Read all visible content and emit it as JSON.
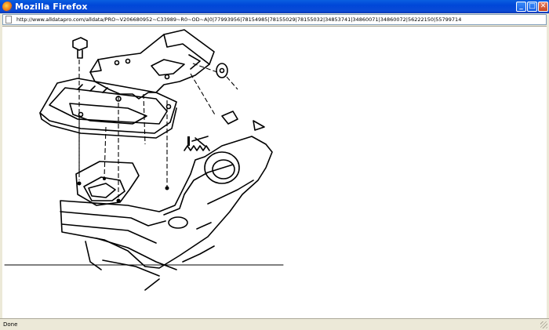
{
  "window": {
    "title": "Mozilla Firefox",
    "minimize_glyph": "_",
    "maximize_glyph": "□",
    "close_glyph": "✕"
  },
  "address_bar": {
    "url": "http://www.alldatapro.com/alldata/PRO~V206680952~C33989~R0~OD~A|0|77993956|78154985|78155029|78155032|34853741|34860071|34860072|56222150|55799714"
  },
  "status_bar": {
    "text": "Done"
  },
  "icons": [
    "firefox-icon",
    "page-icon",
    "resize-grip-icon"
  ]
}
